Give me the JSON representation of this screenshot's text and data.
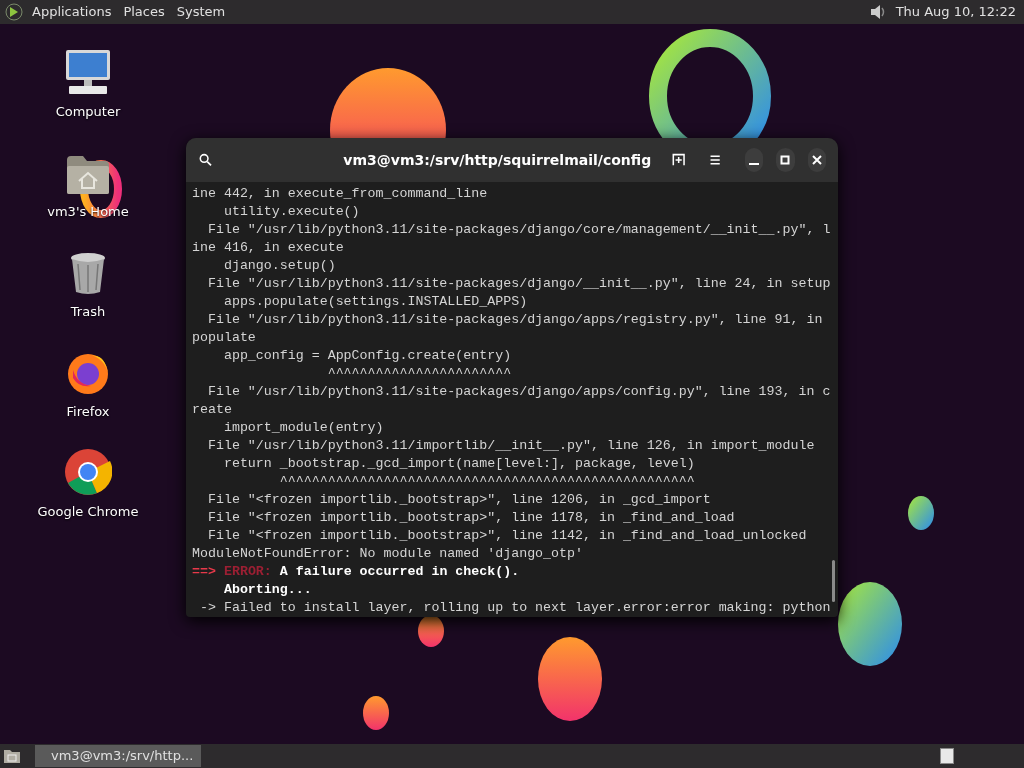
{
  "top_panel": {
    "menus": [
      "Applications",
      "Places",
      "System"
    ],
    "clock": "Thu Aug 10, 12:22"
  },
  "desktop_icons": [
    {
      "kind": "computer",
      "label": "Computer"
    },
    {
      "kind": "home",
      "label": "vm3's Home"
    },
    {
      "kind": "trash",
      "label": "Trash"
    },
    {
      "kind": "firefox",
      "label": "Firefox"
    },
    {
      "kind": "chrome",
      "label": "Google Chrome"
    }
  ],
  "terminal": {
    "title": "vm3@vm3:/srv/http/squirrelmail/config",
    "lines": [
      {
        "kind": "plain",
        "text": "ine 442, in execute_from_command_line"
      },
      {
        "kind": "plain",
        "text": "    utility.execute()"
      },
      {
        "kind": "plain",
        "text": "  File \"/usr/lib/python3.11/site-packages/django/core/management/__init__.py\", l"
      },
      {
        "kind": "plain",
        "text": "ine 416, in execute"
      },
      {
        "kind": "plain",
        "text": "    django.setup()"
      },
      {
        "kind": "plain",
        "text": "  File \"/usr/lib/python3.11/site-packages/django/__init__.py\", line 24, in setup"
      },
      {
        "kind": "plain",
        "text": "    apps.populate(settings.INSTALLED_APPS)"
      },
      {
        "kind": "plain",
        "text": "  File \"/usr/lib/python3.11/site-packages/django/apps/registry.py\", line 91, in"
      },
      {
        "kind": "plain",
        "text": "populate"
      },
      {
        "kind": "plain",
        "text": "    app_config = AppConfig.create(entry)"
      },
      {
        "kind": "plain",
        "text": "                 ^^^^^^^^^^^^^^^^^^^^^^^"
      },
      {
        "kind": "plain",
        "text": "  File \"/usr/lib/python3.11/site-packages/django/apps/config.py\", line 193, in c"
      },
      {
        "kind": "plain",
        "text": "reate"
      },
      {
        "kind": "plain",
        "text": "    import_module(entry)"
      },
      {
        "kind": "plain",
        "text": "  File \"/usr/lib/python3.11/importlib/__init__.py\", line 126, in import_module"
      },
      {
        "kind": "plain",
        "text": "    return _bootstrap._gcd_import(name[level:], package, level)"
      },
      {
        "kind": "plain",
        "text": "           ^^^^^^^^^^^^^^^^^^^^^^^^^^^^^^^^^^^^^^^^^^^^^^^^^^^^"
      },
      {
        "kind": "plain",
        "text": "  File \"<frozen importlib._bootstrap>\", line 1206, in _gcd_import"
      },
      {
        "kind": "plain",
        "text": "  File \"<frozen importlib._bootstrap>\", line 1178, in _find_and_load"
      },
      {
        "kind": "plain",
        "text": "  File \"<frozen importlib._bootstrap>\", line 1142, in _find_and_load_unlocked"
      },
      {
        "kind": "plain",
        "text": "ModuleNotFoundError: No module named 'django_otp'"
      },
      {
        "kind": "error",
        "prefix": "==>",
        "label": "ERROR:",
        "text": "A failure occurred in check()."
      },
      {
        "kind": "bold",
        "text": "    Aborting..."
      },
      {
        "kind": "plain",
        "text": " -> Failed to install layer, rolling up to next layer.error:error making: python"
      }
    ]
  },
  "taskbar": {
    "windows": [
      {
        "label": "vm3@vm3:/srv/http...",
        "selected": true
      }
    ]
  }
}
